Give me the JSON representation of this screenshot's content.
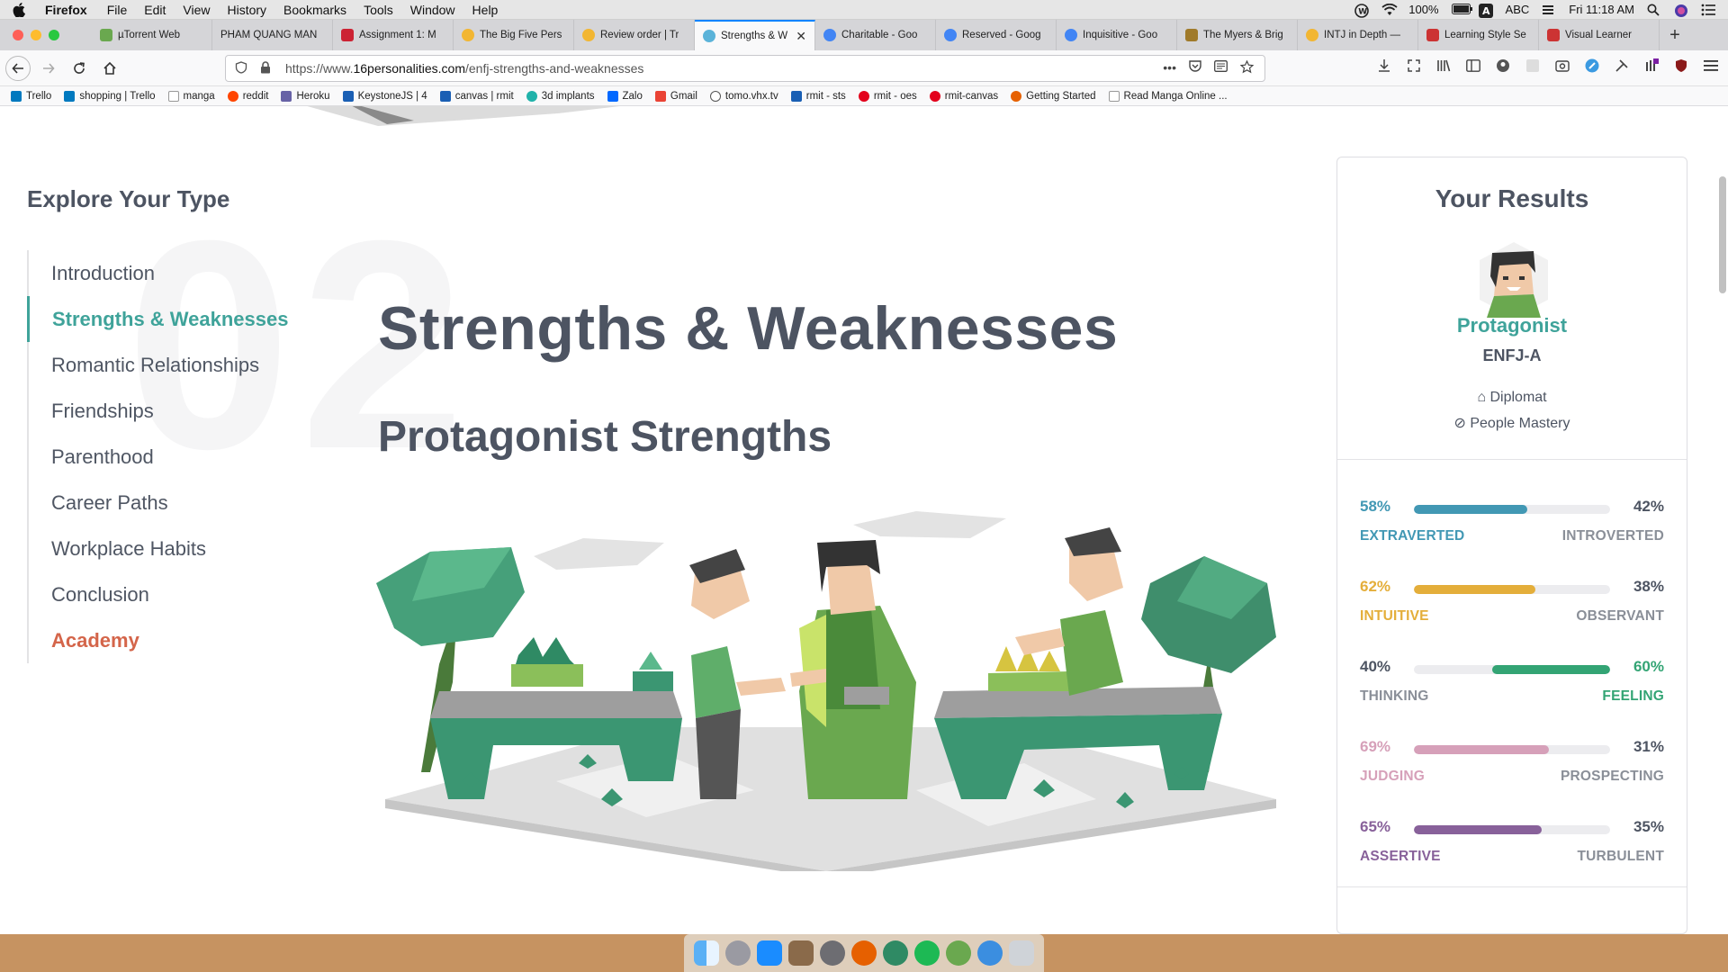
{
  "menubar": {
    "app": "Firefox",
    "items": [
      "File",
      "Edit",
      "View",
      "History",
      "Bookmarks",
      "Tools",
      "Window",
      "Help"
    ],
    "battery": "100%",
    "input_source": "ABC",
    "clock": "Fri 11:18 AM"
  },
  "tabs": [
    {
      "label": "µTorrent Web",
      "color": "#6aa84f"
    },
    {
      "label": "PHAM QUANG MAN",
      "color": "#d5d5d8"
    },
    {
      "label": "Assignment 1: M",
      "color": "#cc2233"
    },
    {
      "label": "The Big Five Pers",
      "color": "#f2b632"
    },
    {
      "label": "Review order | Tr",
      "color": "#f2b632"
    },
    {
      "label": "Strengths & W",
      "color": "#5bb3d9",
      "active": true
    },
    {
      "label": "Charitable - Goo",
      "color": "#4285f4"
    },
    {
      "label": "Reserved - Goog",
      "color": "#4285f4"
    },
    {
      "label": "Inquisitive - Goo",
      "color": "#4285f4"
    },
    {
      "label": "The Myers & Brig",
      "color": "#a07a2a"
    },
    {
      "label": "INTJ in Depth —",
      "color": "#f2b632"
    },
    {
      "label": "Learning Style Se",
      "color": "#cc3333"
    },
    {
      "label": "Visual Learner",
      "color": "#cc3333"
    }
  ],
  "url": {
    "prefix": "https://www.",
    "host": "16personalities.com",
    "path": "/enfj-strengths-and-weaknesses"
  },
  "bookmarks": [
    {
      "label": "Trello",
      "color": "#0079bf"
    },
    {
      "label": "shopping | Trello",
      "color": "#0079bf"
    },
    {
      "label": "manga",
      "color": "#999999"
    },
    {
      "label": "reddit",
      "color": "#ff4500"
    },
    {
      "label": "Heroku",
      "color": "#6762a6"
    },
    {
      "label": "KeystoneJS | 4",
      "color": "#1a5fb4"
    },
    {
      "label": "canvas | rmit",
      "color": "#1a5fb4"
    },
    {
      "label": "3d implants",
      "color": "#20b2aa"
    },
    {
      "label": "Zalo",
      "color": "#0068ff"
    },
    {
      "label": "Gmail",
      "color": "#ea4335"
    },
    {
      "label": "tomo.vhx.tv",
      "color": "#555555"
    },
    {
      "label": "rmit - sts",
      "color": "#1a5fb4"
    },
    {
      "label": "rmit - oes",
      "color": "#e3001b"
    },
    {
      "label": "rmit-canvas",
      "color": "#e3001b"
    },
    {
      "label": "Getting Started",
      "color": "#e66000"
    },
    {
      "label": "Read Manga Online ...",
      "color": "#999999"
    }
  ],
  "sidebar": {
    "title": "Explore Your Type",
    "bignum": "02",
    "items": [
      {
        "label": "Introduction"
      },
      {
        "label": "Strengths & Weaknesses",
        "active": true
      },
      {
        "label": "Romantic Relationships"
      },
      {
        "label": "Friendships"
      },
      {
        "label": "Parenthood"
      },
      {
        "label": "Career Paths"
      },
      {
        "label": "Workplace Habits"
      },
      {
        "label": "Conclusion"
      },
      {
        "label": "Academy",
        "highlight": true
      }
    ]
  },
  "main": {
    "title": "Strengths & Weaknesses",
    "subtitle": "Protagonist Strengths"
  },
  "results": {
    "title": "Your Results",
    "type_name": "Protagonist",
    "type_code": "ENFJ-A",
    "role": "Diplomat",
    "strategy": "People Mastery",
    "traits": [
      {
        "left_pct": "58%",
        "right_pct": "42%",
        "left_label": "EXTRAVERTED",
        "right_label": "INTROVERTED",
        "value": 0.58,
        "side": "left",
        "color": "#4298b4"
      },
      {
        "left_pct": "62%",
        "right_pct": "38%",
        "left_label": "INTUITIVE",
        "right_label": "OBSERVANT",
        "value": 0.62,
        "side": "left",
        "color": "#e4ae3a"
      },
      {
        "left_pct": "40%",
        "right_pct": "60%",
        "left_label": "THINKING",
        "right_label": "FEELING",
        "value": 0.6,
        "side": "right",
        "color": "#33a474"
      },
      {
        "left_pct": "69%",
        "right_pct": "31%",
        "left_label": "JUDGING",
        "right_label": "PROSPECTING",
        "value": 0.69,
        "side": "left",
        "color": "#d6a0b9"
      },
      {
        "left_pct": "65%",
        "right_pct": "35%",
        "left_label": "ASSERTIVE",
        "right_label": "TURBULENT",
        "value": 0.65,
        "side": "left",
        "color": "#88619a"
      }
    ]
  }
}
